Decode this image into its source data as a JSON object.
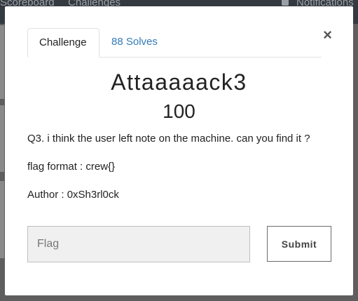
{
  "nav": {
    "items": [
      "Scoreboard",
      "Challenges"
    ],
    "notifications_label": "Notifications"
  },
  "modal": {
    "tabs": [
      "Challenge",
      "88 Solves"
    ],
    "close_symbol": "×",
    "title": "Attaaaaack3",
    "value": "100",
    "description": [
      "Q3. i think the user left note on the machine. can you find it ?",
      "flag format : crew{}",
      "Author : 0xSh3rl0ck"
    ],
    "flag_placeholder": "Flag",
    "submit_label": "Submit"
  }
}
